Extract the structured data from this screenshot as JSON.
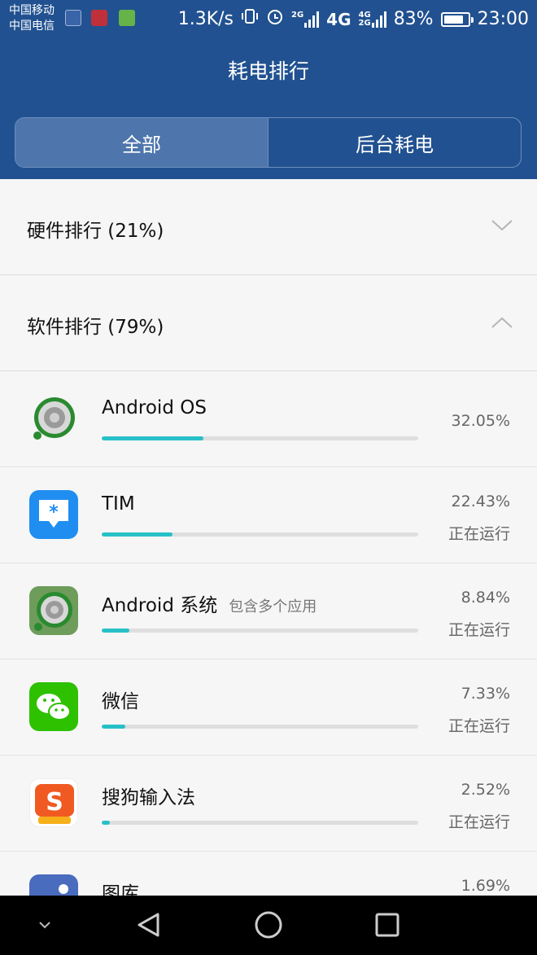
{
  "status_bar": {
    "carrier1": "中国移动",
    "carrier2": "中国电信",
    "net_speed": "1.3K/s",
    "sim1_net": "4G",
    "sim2_top": "4G",
    "sim2_bottom": "2G",
    "alarm_net": "2G",
    "battery_percent": "83%",
    "battery_level": 0.83,
    "time": "23:00"
  },
  "header": {
    "title": "耗电排行",
    "tabs": [
      {
        "label": "全部",
        "active": true
      },
      {
        "label": "后台耗电",
        "active": false
      }
    ]
  },
  "sections": {
    "hardware": {
      "label": "硬件排行 (21%)",
      "expanded": false
    },
    "software": {
      "label": "软件排行 (79%)",
      "expanded": true
    }
  },
  "apps": [
    {
      "name": "Android OS",
      "subtitle": "",
      "percent": "32.05%",
      "value": 32.05,
      "status": "",
      "icon": "android-os-icon"
    },
    {
      "name": "TIM",
      "subtitle": "",
      "percent": "22.43%",
      "value": 22.43,
      "status": "正在运行",
      "icon": "tim-icon"
    },
    {
      "name": "Android 系统",
      "subtitle": "包含多个应用",
      "percent": "8.84%",
      "value": 8.84,
      "status": "正在运行",
      "icon": "android-system-icon"
    },
    {
      "name": "微信",
      "subtitle": "",
      "percent": "7.33%",
      "value": 7.33,
      "status": "正在运行",
      "icon": "wechat-icon"
    },
    {
      "name": "搜狗输入法",
      "subtitle": "",
      "percent": "2.52%",
      "value": 2.52,
      "status": "正在运行",
      "icon": "sogou-input-icon"
    },
    {
      "name": "图库",
      "subtitle": "",
      "percent": "1.69%",
      "value": 1.69,
      "status": "",
      "icon": "gallery-icon"
    }
  ],
  "colors": {
    "header_bg": "#215190",
    "progress": "#28c0c8",
    "navbar": "#000000"
  }
}
